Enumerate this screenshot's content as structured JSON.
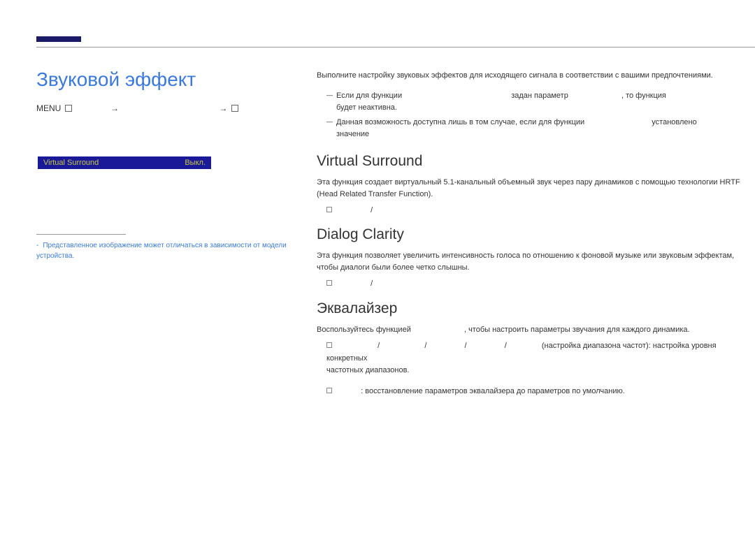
{
  "header": {
    "title": "Звуковой эффект"
  },
  "breadcrumb": {
    "menu": "MENU",
    "arrow1": "→",
    "arrow2": "→"
  },
  "sidebar": {
    "label": "Virtual Surround",
    "value": "Выкл."
  },
  "imageNote": {
    "text": "Представленное изображение может отличаться в зависимости от модели устройства."
  },
  "main": {
    "intro": "Выполните настройку звуковых эффектов для исходящего сигнала в соответствии с вашими предпочтениями.",
    "note1a": "Если для функции",
    "note1b": "задан параметр",
    "note1c": ", то функция",
    "note1d": "будет неактивна.",
    "note2a": "Данная возможность доступна лишь в том случае, если для функции",
    "note2b": "установлено",
    "note2c": "значение",
    "sections": {
      "virtual": {
        "heading": "Virtual Surround",
        "text": "Эта функция создает виртуальный 5.1-канальный объемный звук через пару динамиков с помощью технологии HRTF (Head Related Transfer Function).",
        "sep": "/"
      },
      "dialog": {
        "heading": "Dialog Clarity",
        "text": "Эта функция позволяет увеличить интенсивность голоса по отношению к фоновой музыке или звуковым эффектам, чтобы диалоги были более четко слышны.",
        "sep": "/"
      },
      "eq": {
        "heading": "Эквалайзер",
        "text1a": "Воспользуйтесь функцией",
        "text1b": ", чтобы настроить параметры звучания для каждого динамика.",
        "line1sep": "/",
        "line1tail": "(настройка диапазона частот): настройка уровня конкретных",
        "line1tail2": "частотных диапазонов.",
        "line2": ": восстановление параметров эквалайзера до параметров по умолчанию."
      }
    }
  }
}
